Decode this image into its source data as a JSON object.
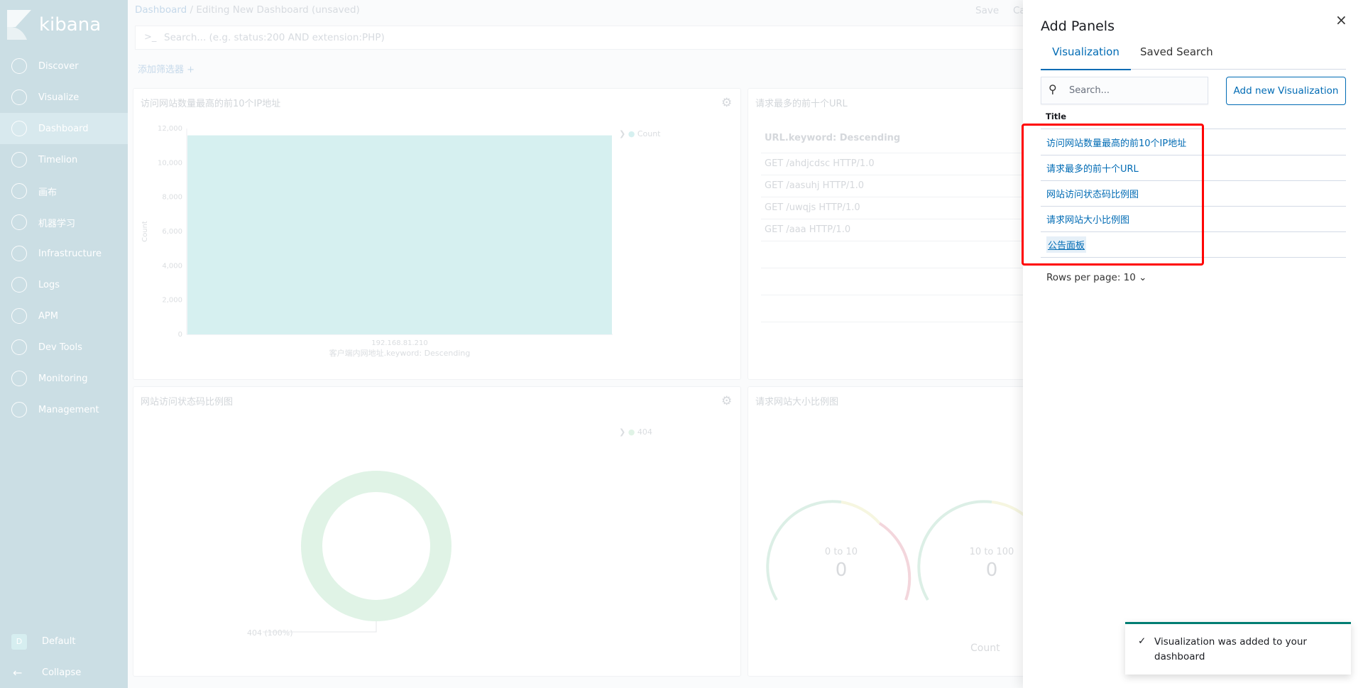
{
  "sidebar": {
    "brand": "kibana",
    "items": [
      {
        "label": "Discover",
        "icon": "compass-icon"
      },
      {
        "label": "Visualize",
        "icon": "chart-icon"
      },
      {
        "label": "Dashboard",
        "icon": "dashboard-icon",
        "active": true
      },
      {
        "label": "Timelion",
        "icon": "timelion-icon"
      },
      {
        "label": "画布",
        "icon": "canvas-icon"
      },
      {
        "label": "机器学习",
        "icon": "ml-icon"
      },
      {
        "label": "Infrastructure",
        "icon": "infrastructure-icon"
      },
      {
        "label": "Logs",
        "icon": "logs-icon"
      },
      {
        "label": "APM",
        "icon": "apm-icon"
      },
      {
        "label": "Dev Tools",
        "icon": "wrench-icon"
      },
      {
        "label": "Monitoring",
        "icon": "heartbeat-icon"
      },
      {
        "label": "Management",
        "icon": "gear-icon"
      }
    ],
    "space_initial": "D",
    "space": "Default",
    "collapse": "Collapse"
  },
  "header": {
    "breadcrumb_root": "Dashboard",
    "breadcrumb_sep": "/",
    "breadcrumb_current": "Editing New Dashboard (unsaved)",
    "save": "Save",
    "cancel": "Ca"
  },
  "search": {
    "prompt": ">_",
    "placeholder": "Search... (e.g. status:200 AND extension:PHP)"
  },
  "filter": {
    "add": "添加筛选器 +"
  },
  "panels": {
    "p1": {
      "title": "访问网站数量最高的前10个IP地址",
      "legend": "Count"
    },
    "p2": {
      "title": "请求最多的前十个URL",
      "header": "URL.keyword: Descending",
      "rows": [
        "GET /ahdjcdsc HTTP/1.0",
        "GET /aasuhj HTTP/1.0",
        "GET /uwqjs HTTP/1.0",
        "GET /aaa HTTP/1.0"
      ]
    },
    "p3": {
      "title": "网站访问状态码比例图",
      "legend": "404",
      "slice_label": "404 (100%)"
    },
    "p4": {
      "title": "请求网站大小比例图",
      "gauges": [
        {
          "label": "0 to 10",
          "value": "0"
        },
        {
          "label": "10 to 100",
          "value": "0"
        }
      ],
      "metric": "Count"
    }
  },
  "chart_data": [
    {
      "type": "bar",
      "categories": [
        "192.168.81.210"
      ],
      "values": [
        11600
      ],
      "ylabel": "Count",
      "xlabel": "客户端内网地址.keyword: Descending",
      "ylim": [
        0,
        12000
      ],
      "yticks": [
        "0",
        "2,000",
        "4,000",
        "6,000",
        "8,000",
        "10,000",
        "12,000"
      ],
      "legend": "Count",
      "color": "#d6f0f0"
    },
    {
      "type": "pie",
      "categories": [
        "404"
      ],
      "values": [
        100
      ],
      "donut": true,
      "color": "#e0f3e6"
    }
  ],
  "flyout": {
    "title": "Add Panels",
    "tabs": [
      {
        "label": "Visualization",
        "active": true
      },
      {
        "label": "Saved Search"
      }
    ],
    "search_placeholder": "Search...",
    "add_button": "Add new Visualization",
    "column": "Title",
    "rows": [
      "访问网站数量最高的前10个IP地址",
      "请求最多的前十个URL",
      "网站访问状态码比例图",
      "请求网站大小比例图",
      "公告面板"
    ],
    "rows_per_page": "Rows per page: 10",
    "close": "×",
    "accent": "#006bb4",
    "highlight": "#ff0000"
  },
  "toast": {
    "message": "Visualization was added to your dashboard",
    "color": "#017d73"
  }
}
